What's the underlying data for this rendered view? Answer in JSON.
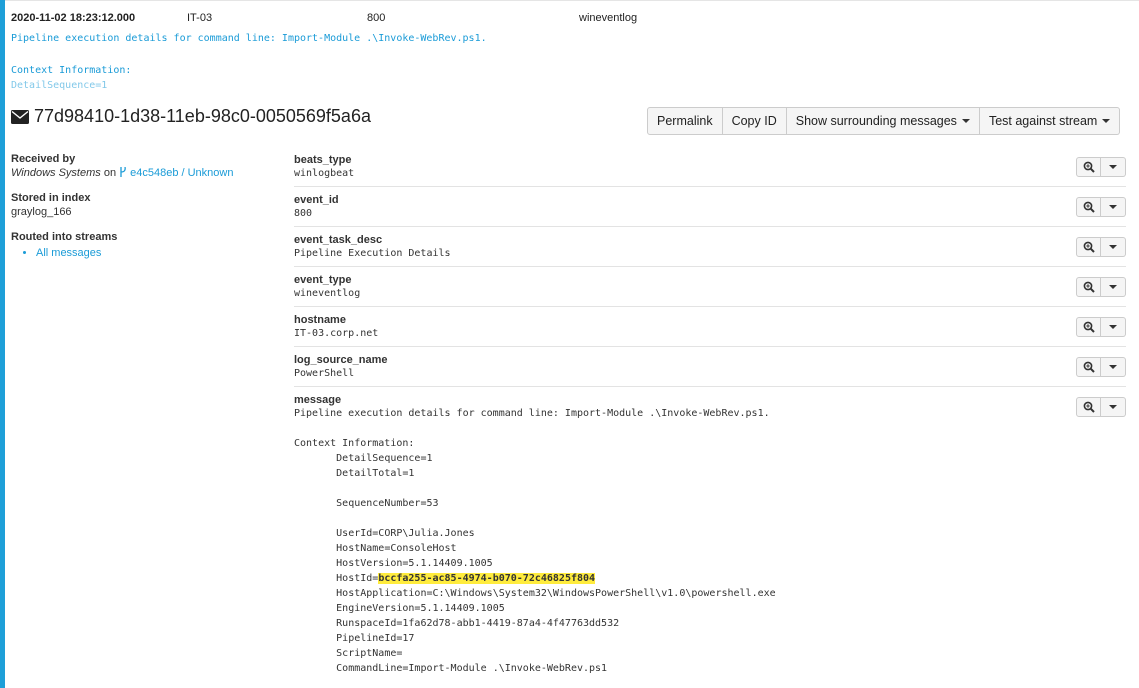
{
  "summary": {
    "timestamp": "2020-11-02 18:23:12.000",
    "source": "IT-03",
    "event_id": "800",
    "channel": "wineventlog"
  },
  "message_preview": {
    "line1": "Pipeline execution details for command line: Import-Module .\\Invoke-WebRev.ps1.",
    "line2": "Context Information:",
    "line3": "DetailSequence=1"
  },
  "message_id": "77d98410-1d38-11eb-98c0-0050569f5a6a",
  "buttons": {
    "permalink": "Permalink",
    "copy_id": "Copy ID",
    "surrounding": "Show surrounding messages",
    "test_stream": "Test against stream"
  },
  "meta": {
    "received_by_label": "Received by",
    "input_name": "Windows Systems",
    "on_text": " on ",
    "node_link": "e4c548eb / Unknown",
    "stored_label": "Stored in index",
    "index_name": "graylog_166",
    "routed_label": "Routed into streams",
    "stream": "All messages"
  },
  "fields": [
    {
      "name": "beats_type",
      "value": "winlogbeat"
    },
    {
      "name": "event_id",
      "value": "800"
    },
    {
      "name": "event_task_desc",
      "value": "Pipeline Execution Details"
    },
    {
      "name": "event_type",
      "value": "wineventlog"
    },
    {
      "name": "hostname",
      "value": "IT-03.corp.net"
    },
    {
      "name": "log_source_name",
      "value": "PowerShell"
    }
  ],
  "message_field": {
    "name": "message",
    "before": "Pipeline execution details for command line: Import-Module .\\Invoke-WebRev.ps1.\n\nContext Information:\n\tDetailSequence=1\n\tDetailTotal=1\n\n\tSequenceNumber=53\n\n\tUserId=CORP\\Julia.Jones\n\tHostName=ConsoleHost\n\tHostVersion=5.1.14409.1005\n\tHostId=",
    "highlight": "bccfa255-ac85-4974-b070-72c46825f804",
    "after": "\n\tHostApplication=C:\\Windows\\System32\\WindowsPowerShell\\v1.0\\powershell.exe\n\tEngineVersion=5.1.14409.1005\n\tRunspaceId=1fa62d78-abb1-4419-87a4-4f47763dd532\n\tPipelineId=17\n\tScriptName=\n\tCommandLine=Import-Module .\\Invoke-WebRev.ps1"
  },
  "colors": {
    "accent": "#1a9bd7",
    "highlight": "#ffec3d"
  },
  "icons": {
    "message": "envelope-icon",
    "node": "node-icon",
    "search": "zoom-in-icon",
    "dropdown": "caret-down-icon"
  }
}
